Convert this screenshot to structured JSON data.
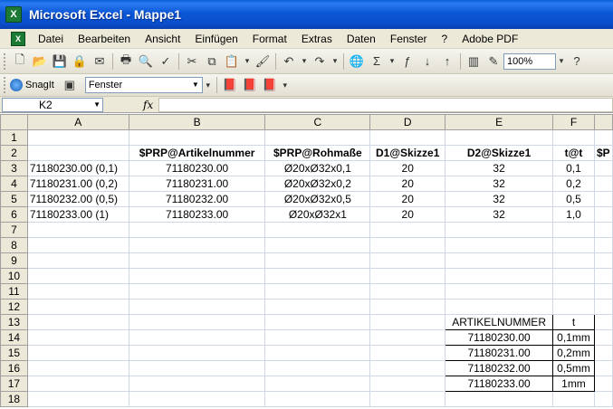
{
  "window": {
    "title": "Microsoft Excel - Mappe1",
    "app_icon": "X"
  },
  "menu": [
    "Datei",
    "Bearbeiten",
    "Ansicht",
    "Einfügen",
    "Format",
    "Extras",
    "Daten",
    "Fenster",
    "?",
    "Adobe PDF"
  ],
  "toolbar": {
    "zoom": "100%"
  },
  "toolbar2": {
    "snagit_label": "SnagIt",
    "fenster_value": "Fenster"
  },
  "formula_bar": {
    "name_box": "K2",
    "fx": "fx",
    "formula": ""
  },
  "grid": {
    "columns": [
      "A",
      "B",
      "C",
      "D",
      "E",
      "F",
      ""
    ],
    "row_numbers": [
      "1",
      "2",
      "3",
      "4",
      "5",
      "6",
      "7",
      "8",
      "9",
      "10",
      "11",
      "12",
      "13",
      "14",
      "15",
      "16",
      "17",
      "18"
    ],
    "header_row": [
      "",
      "$PRP@Artikelnummer",
      "$PRP@Rohmaße",
      "D1@Skizze1",
      "D2@Skizze1",
      "t@t",
      "$P"
    ],
    "data_rows": [
      [
        "71180230.00 (0,1)",
        "71180230.00",
        "Ø20xØ32x0,1",
        "20",
        "32",
        "0,1"
      ],
      [
        "71180231.00 (0,2)",
        "71180231.00",
        "Ø20xØ32x0,2",
        "20",
        "32",
        "0,2"
      ],
      [
        "71180232.00 (0,5)",
        "71180232.00",
        "Ø20xØ32x0,5",
        "20",
        "32",
        "0,5"
      ],
      [
        "71180233.00 (1)",
        "71180233.00",
        "Ø20xØ32x1",
        "20",
        "32",
        "1,0"
      ]
    ],
    "lookup_table": {
      "headers": [
        "ARTIKELNUMMER",
        "t"
      ],
      "rows": [
        [
          "71180230.00",
          "0,1mm"
        ],
        [
          "71180231.00",
          "0,2mm"
        ],
        [
          "71180232.00",
          "0,5mm"
        ],
        [
          "71180233.00",
          "1mm"
        ]
      ]
    }
  }
}
